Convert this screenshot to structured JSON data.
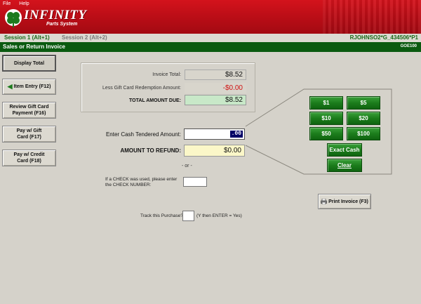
{
  "menu": {
    "file": "File",
    "help": "Help"
  },
  "brand": {
    "name": "NFINITY",
    "initial": "I",
    "subtitle": "Parts System"
  },
  "session": {
    "session1": "Session 1 (Alt+1)",
    "session2": "Session 2 (Alt+2)",
    "user": "RJOHNSO2*G_434506*P1"
  },
  "title": {
    "text": "Sales or Return Invoice",
    "code": "GOE100"
  },
  "left_buttons": {
    "display_total": "Display Total",
    "item_entry": "Item Entry (F12)",
    "review_gift": "Review Gift Card Payment (F16)",
    "pay_gift": "Pay w/ Gift Card (F17)",
    "pay_credit": "Pay w/ Credit Card (F18)"
  },
  "totals": {
    "invoice_total_label": "Invoice Total:",
    "invoice_total": "$8.52",
    "gift_label": "Less Gift Card Redemption Amount:",
    "gift_amount": "-$0.00",
    "due_label": "TOTAL AMOUNT DUE:",
    "due_amount": "$8.52"
  },
  "cash": {
    "tendered_label": "Enter Cash Tendered Amount:",
    "tendered_value": ".00",
    "refund_label": "AMOUNT TO REFUND:",
    "refund_value": "$0.00",
    "or": "- or -",
    "check_label": "If a CHECK was used, please enter the CHECK NUMBER:",
    "track_label": "Track this Purchase?",
    "track_hint": "(Y then ENTER = Yes)"
  },
  "cash_buttons": {
    "b1": "$1",
    "b5": "$5",
    "b10": "$10",
    "b20": "$20",
    "b50": "$50",
    "b100": "$100",
    "exact": "Exact Cash",
    "clear": "Clear"
  },
  "print_button": "Print Invoice (F3)",
  "colors": {
    "banner_red": "#c8121b",
    "title_green": "#0a5a10",
    "button_green": "#1c7d1c",
    "refund_yellow": "#fbf7c8",
    "due_green": "#c8e8c8",
    "negative_red": "#d01010"
  }
}
